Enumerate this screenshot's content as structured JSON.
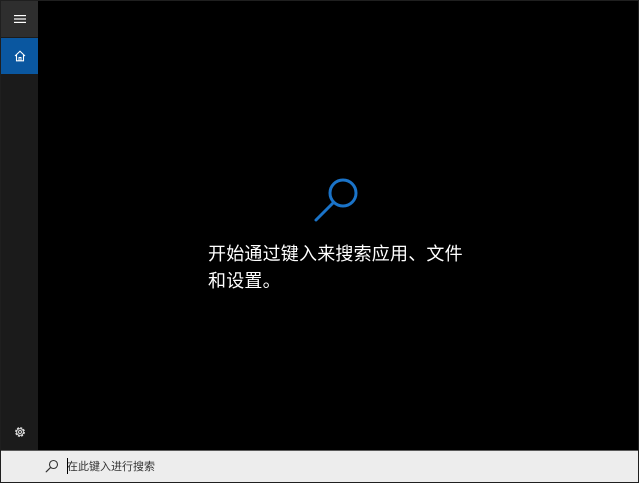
{
  "sidebar": {
    "menu_icon": "hamburger-icon",
    "home_icon": "home-icon",
    "settings_icon": "gear-icon"
  },
  "main": {
    "hint_line1": "开始通过键入来搜索应用、文件",
    "hint_line2": "和设置。",
    "hero_icon": "search-icon"
  },
  "search": {
    "placeholder": "在此键入进行搜索",
    "value": ""
  },
  "colors": {
    "accent": "#0a57a0",
    "hero_icon": "#1a73c8",
    "background": "#000000",
    "sidebar": "#1b1b1b",
    "searchbar": "#ededed"
  }
}
